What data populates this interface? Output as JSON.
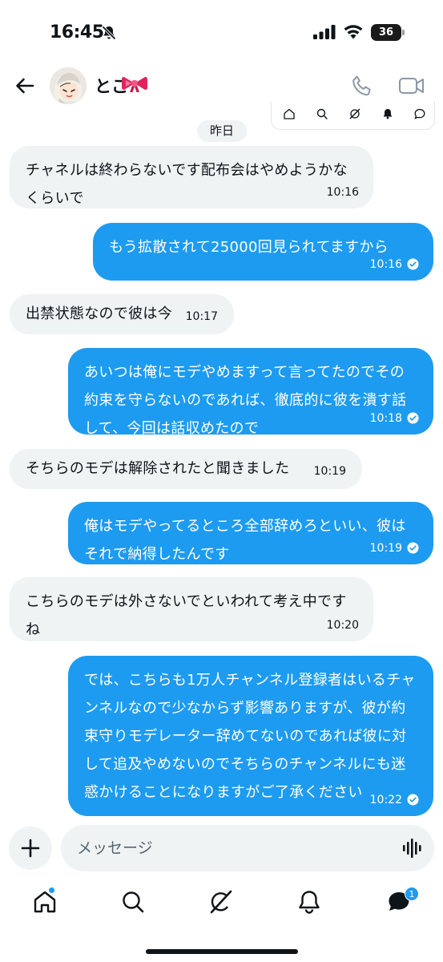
{
  "status_bar": {
    "time": "16:45",
    "battery": "36"
  },
  "header": {
    "contact_name": "とこ"
  },
  "date_divider": "昨日",
  "messages": [
    {
      "dir": "in",
      "text": "チャネルは終わらないです配布会はやめようかなくらいで",
      "time": "10:16"
    },
    {
      "dir": "out",
      "text": "もう拡散されて25000回見られてますから",
      "time": "10:16",
      "read": true
    },
    {
      "dir": "in",
      "text": "出禁状態なので彼は今",
      "time": "10:17"
    },
    {
      "dir": "out",
      "text": "あいつは俺にモデやめますって言ってたのでその約束を守らないのであれば、徹底的に彼を潰す話して、今回は話収めたので",
      "time": "10:18",
      "read": true
    },
    {
      "dir": "in",
      "text": "そちらのモデは解除されたと聞きました",
      "time": "10:19"
    },
    {
      "dir": "out",
      "text": "俺はモデやってるところ全部辞めろといい、彼はそれで納得したんです",
      "time": "10:19",
      "read": true
    },
    {
      "dir": "in",
      "text": "こちらのモデは外さないでといわれて考え中ですね",
      "time": "10:20"
    },
    {
      "dir": "out",
      "text": "では、こちらも1万人チャンネル登録者はいるチャンネルなので少なからず影響ありますが、彼が約束守りモデレーター辞めてないのであれば彼に対して追及やめないのでそちらのチャンネルにも迷惑かけることになりますがご了承ください",
      "time": "10:22",
      "read": true
    }
  ],
  "composer": {
    "placeholder": "メッセージ"
  },
  "bottom_nav": {
    "items": [
      "home-icon",
      "search-icon",
      "grok-icon",
      "notifications-icon",
      "messages-icon"
    ],
    "messages_badge": "1"
  },
  "icons": {
    "mute": "bell-slash-icon",
    "signal": "signal-icon",
    "wifi": "wifi-icon",
    "back": "arrow-left-icon",
    "ribbon": "ribbon-emoji",
    "call": "phone-icon",
    "video": "video-camera-icon",
    "read_receipt": "check-circle-icon",
    "add": "plus-icon",
    "voice": "voice-wave-icon"
  },
  "colors": {
    "accent": "#1d9bf0",
    "incoming_bubble": "#eff3f4",
    "text": "#0f1419",
    "ribbon": "#e0245e"
  }
}
